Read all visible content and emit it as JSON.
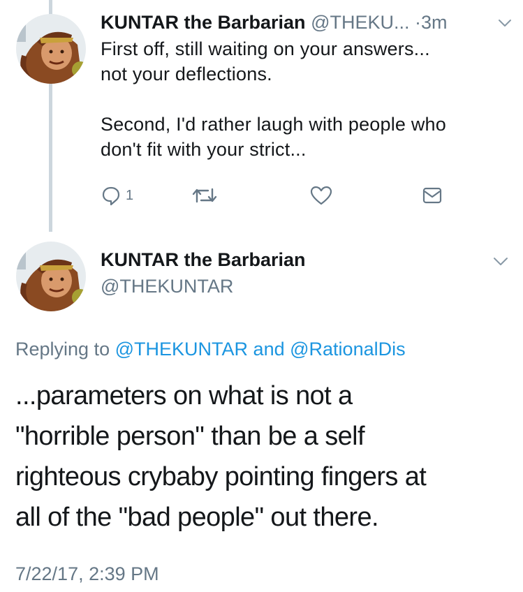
{
  "tweet1": {
    "author_name": "KUNTAR the Barbarian",
    "author_handle": "@THEKU...",
    "separator": "·",
    "time": "3m",
    "text": "First off, still waiting on your answers...\nnot your deflections.\n\nSecond, I'd rather laugh with people who\ndon't fit with your strict...",
    "reply_count": "1",
    "icons": {
      "reply": "reply-icon",
      "retweet": "retweet-icon",
      "like": "heart-icon",
      "dm": "envelope-icon",
      "more": "chevron-down-icon"
    }
  },
  "tweet2": {
    "author_name": "KUNTAR the Barbarian",
    "author_handle": "@THEKUNTAR",
    "replying_prefix": "Replying to",
    "replying_user1": "@THEKUNTAR",
    "replying_and": "and",
    "replying_user2": "@RationalDis",
    "text": "...parameters on what is not a\n\"horrible person\" than be a self\nrighteous crybaby pointing fingers at\nall of the \"bad people\" out there.",
    "timestamp": "7/22/17, 2:39 PM"
  },
  "colors": {
    "text": "#14171a",
    "secondary": "#657786",
    "link": "#1b95e0",
    "thread_line": "#ccd6dd",
    "icon": "#8899a6"
  }
}
